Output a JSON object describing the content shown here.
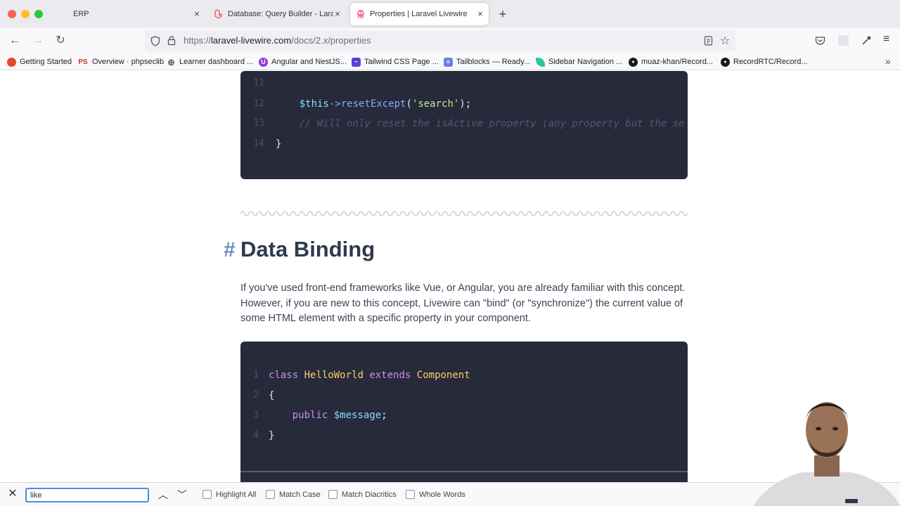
{
  "browser": {
    "tabs": [
      {
        "title": "ERP",
        "favicon": "blank-favicon",
        "active": false
      },
      {
        "title": "Database: Query Builder - Laravel",
        "favicon": "laravel-icon",
        "active": false
      },
      {
        "title": "Properties | Laravel Livewire",
        "favicon": "livewire-icon",
        "active": true
      }
    ],
    "close_glyph": "×",
    "new_tab_glyph": "+",
    "url": {
      "scheme": "https://",
      "host": "laravel-livewire.com",
      "path": "/docs/2.x/properties"
    },
    "bookmarks": [
      {
        "label": "Getting Started",
        "icon": "firefox-icon",
        "color": "#e8482a",
        "glyph": ""
      },
      {
        "label": "Overview · phpseclib",
        "icon": "ps-icon",
        "color": "#ffffff",
        "glyph": "PS"
      },
      {
        "label": "Learner dashboard ...",
        "icon": "globe-icon",
        "color": "#ffffff",
        "glyph": "⊕"
      },
      {
        "label": "Angular and NestJS...",
        "icon": "udemy-icon",
        "color": "#8a3ad8",
        "glyph": "U"
      },
      {
        "label": "Tailwind CSS Page ...",
        "icon": "tailwind-icon",
        "color": "#5b3fd6",
        "glyph": "~"
      },
      {
        "label": "Tailblocks — Ready...",
        "icon": "tailblocks-icon",
        "color": "#6b7ee8",
        "glyph": "≡"
      },
      {
        "label": "Sidebar Navigation ...",
        "icon": "leaf-icon",
        "color": "#2ec4a0",
        "glyph": ""
      },
      {
        "label": "muaz-khan/Record...",
        "icon": "github-icon",
        "color": "#1b1b1b",
        "glyph": "●"
      },
      {
        "label": "RecordRTC/Record...",
        "icon": "github-icon",
        "color": "#1b1b1b",
        "glyph": "●"
      }
    ]
  },
  "code_top": {
    "lines": [
      {
        "num": "11",
        "html": ""
      },
      {
        "num": "12",
        "html": "    <span class=\"var\">$this</span><span class=\"fn\">-&gt;resetExcept</span><span class=\"punc\">(</span><span class=\"str\">'search'</span><span class=\"punc\">);</span>"
      },
      {
        "num": "13",
        "html": "    <span class=\"com\">// Will only reset the isActive property (any property but the se</span>"
      },
      {
        "num": "14",
        "html": "<span class=\"punc\">}</span>"
      }
    ]
  },
  "section": {
    "hash": "#",
    "title": "Data Binding",
    "paragraph": "If you've used front-end frameworks like Vue, or Angular, you are already familiar with this concept. However, if you are new to this concept, Livewire can \"bind\" (or \"synchronize\") the current value of some HTML element with a specific property in your component."
  },
  "code_bottom": {
    "lines": [
      {
        "num": "1",
        "html": "<span class=\"kw\">class</span> <span class=\"cls\">HelloWorld</span> <span class=\"kw\">extends</span> <span class=\"cls\">Component</span>"
      },
      {
        "num": "2",
        "html": "<span class=\"punc\">{</span>"
      },
      {
        "num": "3",
        "html": "    <span class=\"kw\">public</span> <span class=\"var\">$message</span><span class=\"punc\">;</span>"
      },
      {
        "num": "4",
        "html": "<span class=\"punc\">}</span>"
      }
    ]
  },
  "findbar": {
    "query": "like",
    "options": [
      "Highlight All",
      "Match Case",
      "Match Diacritics",
      "Whole Words"
    ]
  },
  "colors": {
    "code_bg": "#262a3a",
    "heading": "#2e3a4d",
    "hash": "#6b8fb5",
    "focus": "#4a90d9"
  }
}
